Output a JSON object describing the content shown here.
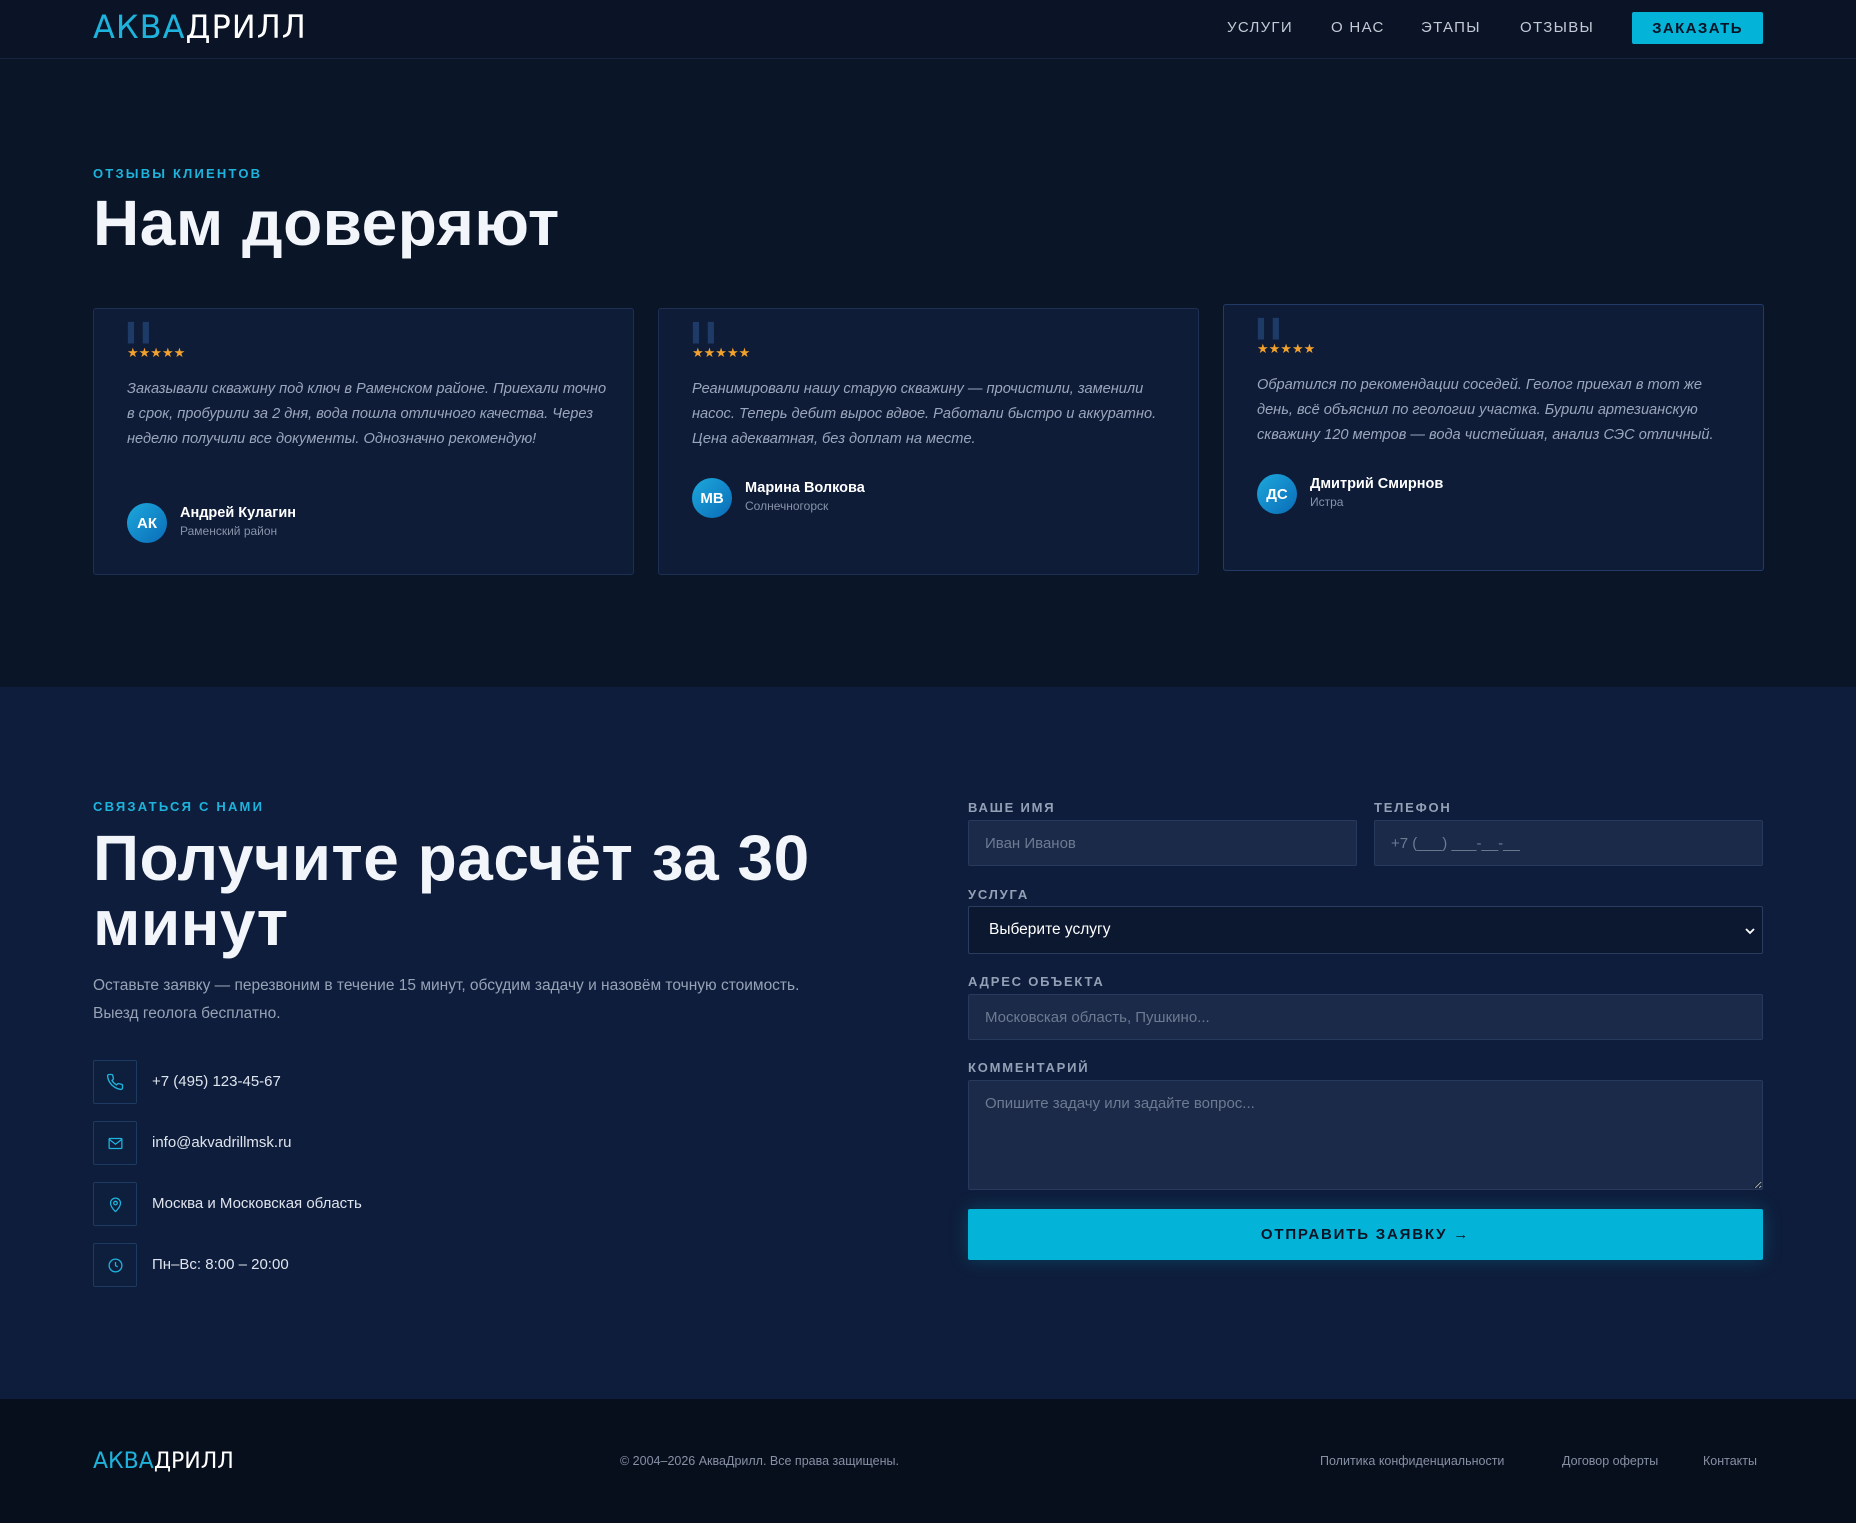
{
  "header": {
    "logo_part1": "АКВА",
    "logo_part2": "ДРИЛЛ",
    "nav": [
      "УСЛУГИ",
      "О НАС",
      "ЭТАПЫ",
      "ОТЗЫВЫ"
    ],
    "order_button": "ЗАКАЗАТЬ"
  },
  "reviews": {
    "eyebrow": "ОТЗЫВЫ КЛИЕНТОВ",
    "title": "Нам доверяют",
    "items": [
      {
        "stars": "★★★★★",
        "text": "Заказывали скважину под ключ в Раменском районе. Приехали точно в срок, пробурили за 2 дня, вода пошла отличного качества. Через неделю получили все документы. Однозначно рекомендую!",
        "initials": "АК",
        "name": "Андрей Кулагин",
        "city": "Раменский район"
      },
      {
        "stars": "★★★★★",
        "text": "Реанимировали нашу старую скважину — прочистили, заменили насос. Теперь дебит вырос вдвое. Работали быстро и аккуратно. Цена адекватная, без доплат на месте.",
        "initials": "МВ",
        "name": "Марина Волкова",
        "city": "Солнечногорск"
      },
      {
        "stars": "★★★★★",
        "text": "Обратился по рекомендации соседей. Геолог приехал в тот же день, всё объяснил по геологии участка. Бурили артезианскую скважину 120 метров — вода чистейшая, анализ СЭС отличный.",
        "initials": "ДС",
        "name": "Дмитрий Смирнов",
        "city": "Истра"
      }
    ]
  },
  "contact": {
    "eyebrow": "СВЯЗАТЬСЯ С НАМИ",
    "title_line1": "Получите расчёт за 30",
    "title_line2": "минут",
    "lead_line1": "Оставьте заявку — перезвоним в течение 15 минут, обсудим задачу и назовём точную стоимость.",
    "lead_line2": "Выезд геолога бесплатно.",
    "phone": "+7 (495) 123-45-67",
    "email": "info@akvadrillmsk.ru",
    "region": "Москва и Московская область",
    "hours": "Пн–Вс: 8:00 – 20:00"
  },
  "form": {
    "name_label": "ВАШЕ ИМЯ",
    "name_placeholder": "Иван Иванов",
    "phone_label": "ТЕЛЕФОН",
    "phone_placeholder": "+7 (___) ___-__-__",
    "service_label": "УСЛУГА",
    "service_value": "Выберите услугу",
    "address_label": "АДРЕС ОБЪЕКТА",
    "address_placeholder": "Московская область, Пушкино...",
    "comment_label": "КОММЕНТАРИЙ",
    "comment_placeholder": "Опишите задачу или задайте вопрос...",
    "submit": "ОТПРАВИТЬ ЗАЯВКУ →"
  },
  "footer": {
    "logo_part1": "АКВА",
    "logo_part2": "ДРИЛЛ",
    "copyright": "© 2004–2026 АкваДрилл. Все права защищены.",
    "links": [
      "Политика конфиденциальности",
      "Договор оферты",
      "Контакты"
    ]
  },
  "colors": {
    "accent": "#04b4d8",
    "background": "#0b1528",
    "stars": "#f2a12c"
  }
}
